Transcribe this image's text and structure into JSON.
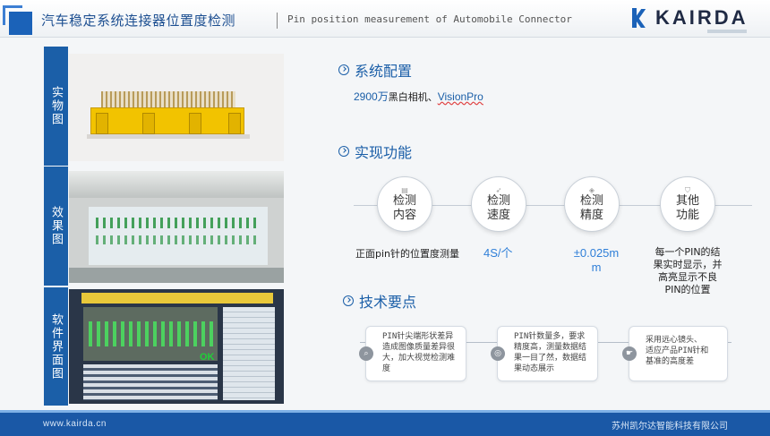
{
  "header": {
    "title_cn": "汽车稳定系统连接器位置度检测",
    "title_en": "Pin position measurement of Automobile Connector",
    "logo_text": "KAIRDA"
  },
  "left_panels": [
    {
      "label": "实物图"
    },
    {
      "label": "效果图"
    },
    {
      "label": "软件界面图"
    }
  ],
  "software_screen": {
    "ok_text": "OK"
  },
  "config": {
    "heading": "系统配置",
    "resolution": "2900万",
    "camera": "黑白相机、",
    "software": "VisionPro"
  },
  "functions": {
    "heading": "实现功能",
    "items": [
      {
        "line1": "检测",
        "line2": "内容",
        "icon": "document-icon",
        "value": "正面pin针的位置度测量"
      },
      {
        "line1": "检测",
        "line2": "速度",
        "icon": "rocket-icon",
        "value": "4S/个"
      },
      {
        "line1": "检测",
        "line2": "精度",
        "icon": "ruler-icon",
        "value_line1": "±0.025m",
        "value_line2": "m"
      },
      {
        "line1": "其他",
        "line2": "功能",
        "icon": "shield-icon",
        "value_line1": "每一个PIN的结",
        "value_line2": "果实时显示，并",
        "value_line3": "高亮显示不良",
        "value_line4": "PIN的位置"
      }
    ]
  },
  "key_points": {
    "heading": "技术要点",
    "items": [
      {
        "icon": "search-icon",
        "lines": [
          "PIN针尖端形状差异",
          "造成图像质量差异很",
          "大，加大视觉检测难",
          "度"
        ]
      },
      {
        "icon": "target-icon",
        "lines": [
          "PIN针数量多，要求",
          "精度高，测量数据结",
          "果一目了然，数据结",
          "果动态展示"
        ]
      },
      {
        "icon": "hand-icon",
        "lines": [
          "采用远心镜头、",
          "适应产品PIN针和",
          "基准的高度差"
        ]
      }
    ]
  },
  "footer": {
    "url": "www.kairda.cn",
    "company": "苏州凯尔达智能科技有限公司"
  },
  "colors": {
    "brand_blue": "#1b5fa8",
    "footer_blue": "#1a58a6",
    "value_blue": "#2f7fd8"
  }
}
